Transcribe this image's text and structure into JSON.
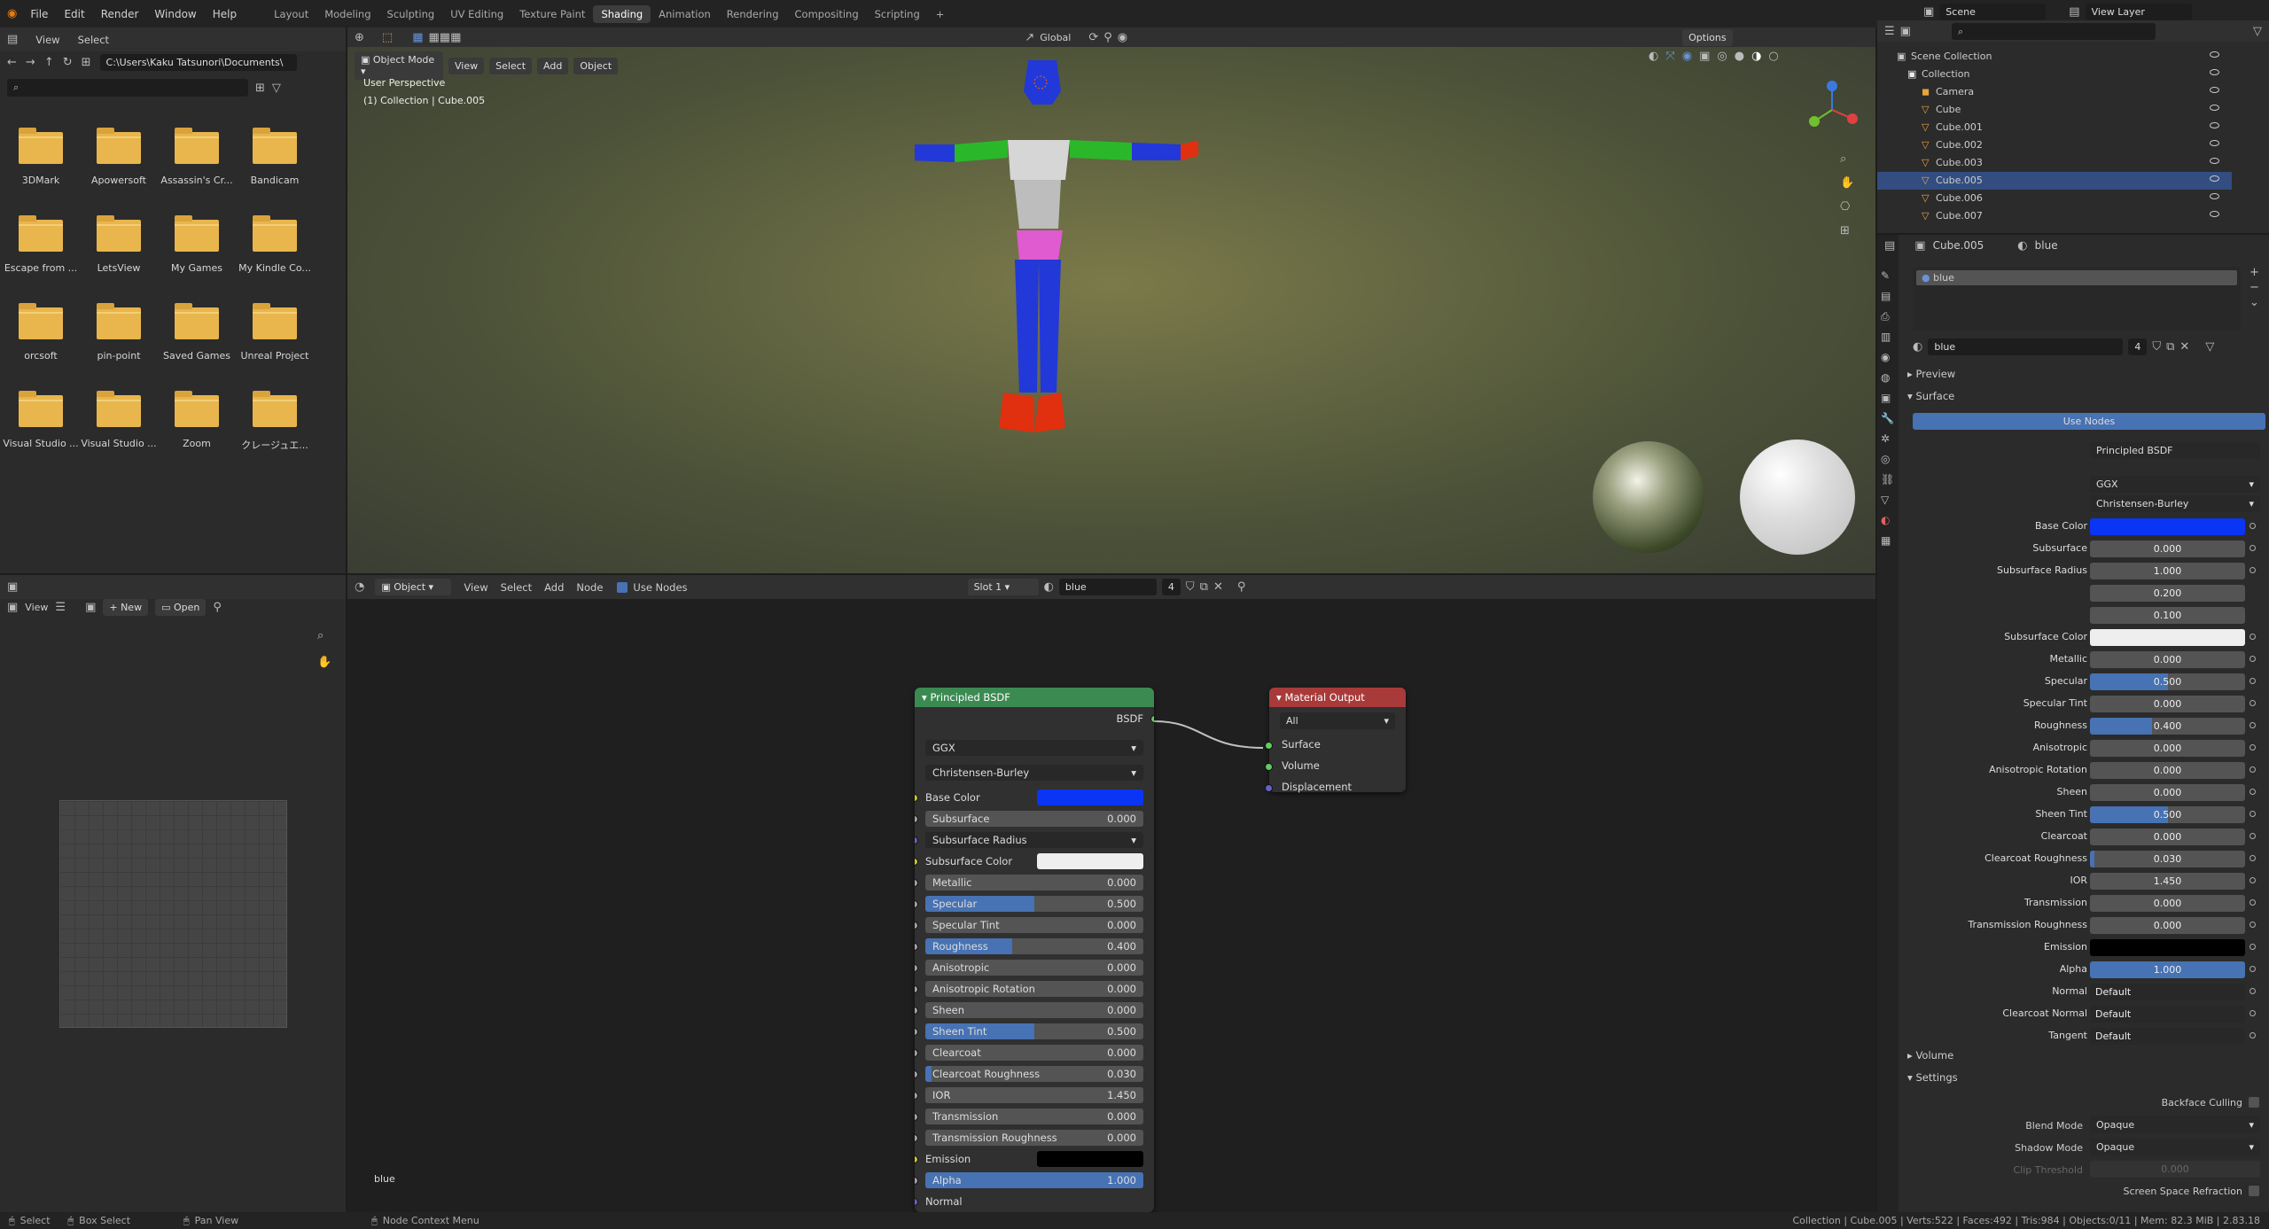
{
  "menu": [
    "File",
    "Edit",
    "Render",
    "Window",
    "Help"
  ],
  "workspaces": [
    "Layout",
    "Modeling",
    "Sculpting",
    "UV Editing",
    "Texture Paint",
    "Shading",
    "Animation",
    "Rendering",
    "Compositing",
    "Scripting"
  ],
  "active_workspace": "Shading",
  "top_right": {
    "scene": "Scene",
    "view_layer": "View Layer"
  },
  "file_browser": {
    "menu": [
      "View",
      "Select"
    ],
    "path": "C:\\Users\\Kaku Tatsunori\\Documents\\",
    "folders": [
      "3DMark",
      "Apowersoft",
      "Assassin's Cr...",
      "Bandicam",
      "Escape from ...",
      "LetsView",
      "My Games",
      "My Kindle Co...",
      "orcsoft",
      "pin-point",
      "Saved Games",
      "Unreal Project",
      "Visual Studio ...",
      "Visual Studio ...",
      "Zoom",
      "クレージュエ..."
    ]
  },
  "viewport": {
    "mode": "Object Mode",
    "menu": [
      "View",
      "Select",
      "Add",
      "Object"
    ],
    "transform": "Global",
    "options": "Options",
    "perspective": "User Perspective",
    "collection_info": "(1) Collection | Cube.005"
  },
  "image_editor": {
    "view": "View",
    "new": "New",
    "open": "Open"
  },
  "node_editor": {
    "type": "Object",
    "menu": [
      "View",
      "Select",
      "Add",
      "Node"
    ],
    "use_nodes": "Use Nodes",
    "slot": "Slot 1",
    "material": "blue",
    "users": "4",
    "footer_label": "blue",
    "bsdf": {
      "title": "Principled BSDF",
      "output": "BSDF",
      "distribution": "GGX",
      "subsurface_method": "Christensen-Burley",
      "base_color_label": "Base Color",
      "base_color": "#0b35f5",
      "subsurface_color_label": "Subsurface Color",
      "subsurface_radius_label": "Subsurface Radius",
      "emission_label": "Emission",
      "normal_label": "Normal",
      "sliders": [
        {
          "label": "Subsurface",
          "value": "0.000",
          "fill": 0
        },
        {
          "label": "Metallic",
          "value": "0.000",
          "fill": 0
        },
        {
          "label": "Specular",
          "value": "0.500",
          "fill": 0.5
        },
        {
          "label": "Specular Tint",
          "value": "0.000",
          "fill": 0
        },
        {
          "label": "Roughness",
          "value": "0.400",
          "fill": 0.4
        },
        {
          "label": "Anisotropic",
          "value": "0.000",
          "fill": 0
        },
        {
          "label": "Anisotropic Rotation",
          "value": "0.000",
          "fill": 0
        },
        {
          "label": "Sheen",
          "value": "0.000",
          "fill": 0
        },
        {
          "label": "Sheen Tint",
          "value": "0.500",
          "fill": 0.5
        },
        {
          "label": "Clearcoat",
          "value": "0.000",
          "fill": 0
        },
        {
          "label": "Clearcoat Roughness",
          "value": "0.030",
          "fill": 0.03
        },
        {
          "label": "IOR",
          "value": "1.450",
          "fill": 0
        },
        {
          "label": "Transmission",
          "value": "0.000",
          "fill": 0
        },
        {
          "label": "Transmission Roughness",
          "value": "0.000",
          "fill": 0
        },
        {
          "label": "Alpha",
          "value": "1.000",
          "fill": 1
        }
      ]
    },
    "output": {
      "title": "Material Output",
      "target": "All",
      "inputs": [
        "Surface",
        "Volume",
        "Displacement"
      ]
    }
  },
  "outliner": {
    "root": "Scene Collection",
    "collection": "Collection",
    "items": [
      "Camera",
      "Cube",
      "Cube.001",
      "Cube.002",
      "Cube.003",
      "Cube.005",
      "Cube.006",
      "Cube.007"
    ]
  },
  "properties": {
    "object": "Cube.005",
    "material_tab": "blue",
    "slot_name": "blue",
    "material": "blue",
    "users": "4",
    "sections": {
      "preview": "Preview",
      "surface": "Surface",
      "volume": "Volume",
      "settings": "Settings"
    },
    "use_nodes": "Use Nodes",
    "surface_label": "Surface",
    "surface_value": "Principled BSDF",
    "distribution": "GGX",
    "subsurface_method": "Christensen-Burley",
    "rows": [
      {
        "label": "Base Color",
        "type": "color",
        "color": "#0b35f5"
      },
      {
        "label": "Subsurface",
        "value": "0.000",
        "fill": 0
      },
      {
        "label": "Subsurface Radius",
        "value": "1.000",
        "fill": 0
      },
      {
        "label": "",
        "value": "0.200",
        "fill": 0
      },
      {
        "label": "",
        "value": "0.100",
        "fill": 0
      },
      {
        "label": "Subsurface Color",
        "type": "color",
        "color": "#eeeeee"
      },
      {
        "label": "Metallic",
        "value": "0.000",
        "fill": 0
      },
      {
        "label": "Specular",
        "value": "0.500",
        "fill": 0.5
      },
      {
        "label": "Specular Tint",
        "value": "0.000",
        "fill": 0
      },
      {
        "label": "Roughness",
        "value": "0.400",
        "fill": 0.4
      },
      {
        "label": "Anisotropic",
        "value": "0.000",
        "fill": 0
      },
      {
        "label": "Anisotropic Rotation",
        "value": "0.000",
        "fill": 0
      },
      {
        "label": "Sheen",
        "value": "0.000",
        "fill": 0
      },
      {
        "label": "Sheen Tint",
        "value": "0.500",
        "fill": 0.5
      },
      {
        "label": "Clearcoat",
        "value": "0.000",
        "fill": 0
      },
      {
        "label": "Clearcoat Roughness",
        "value": "0.030",
        "fill": 0.03
      },
      {
        "label": "IOR",
        "value": "1.450",
        "fill": 0
      },
      {
        "label": "Transmission",
        "value": "0.000",
        "fill": 0
      },
      {
        "label": "Transmission Roughness",
        "value": "0.000",
        "fill": 0
      },
      {
        "label": "Emission",
        "type": "color",
        "color": "#000000"
      },
      {
        "label": "Alpha",
        "value": "1.000",
        "fill": 1
      },
      {
        "label": "Normal",
        "type": "text",
        "value": "Default"
      },
      {
        "label": "Clearcoat Normal",
        "type": "text",
        "value": "Default"
      },
      {
        "label": "Tangent",
        "type": "text",
        "value": "Default"
      }
    ],
    "settings": {
      "backface_culling": "Backface Culling",
      "blend_mode_label": "Blend Mode",
      "blend_mode": "Opaque",
      "shadow_mode_label": "Shadow Mode",
      "shadow_mode": "Opaque",
      "clip_threshold_label": "Clip Threshold",
      "clip_threshold": "0.000",
      "ssr": "Screen Space Refraction"
    }
  },
  "status": {
    "select": "Select",
    "box_select": "Box Select",
    "pan_view": "Pan View",
    "context": "Node Context Menu",
    "stats": "Collection | Cube.005 | Verts:522 | Faces:492 | Tris:984 | Objects:0/11 | Mem: 82.3 MiB | 2.83.18"
  }
}
